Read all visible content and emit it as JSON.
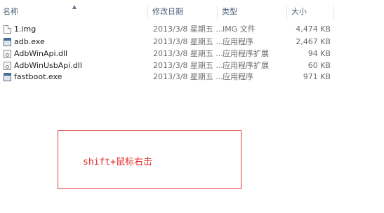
{
  "columns": {
    "name": "名称",
    "date": "修改日期",
    "type": "类型",
    "size": "大小"
  },
  "files": [
    {
      "name": "1.img",
      "date": "2013/3/8 星期五 ...",
      "type": "IMG 文件",
      "size": "4,474 KB",
      "icon": "image-file-icon"
    },
    {
      "name": "adb.exe",
      "date": "2013/3/8 星期五 ...",
      "type": "应用程序",
      "size": "2,467 KB",
      "icon": "exe-file-icon"
    },
    {
      "name": "AdbWinApi.dll",
      "date": "2013/3/8 星期五 ...",
      "type": "应用程序扩展",
      "size": "94 KB",
      "icon": "dll-file-icon"
    },
    {
      "name": "AdbWinUsbApi.dll",
      "date": "2013/3/8 星期五 ...",
      "type": "应用程序扩展",
      "size": "60 KB",
      "icon": "dll-file-icon"
    },
    {
      "name": "fastboot.exe",
      "date": "2013/3/8 星期五 ...",
      "type": "应用程序",
      "size": "971 KB",
      "icon": "exe-file-icon",
      "selected": true
    }
  ],
  "annotation": {
    "text": "shift+鼠标右击",
    "color": "#e0302f"
  }
}
